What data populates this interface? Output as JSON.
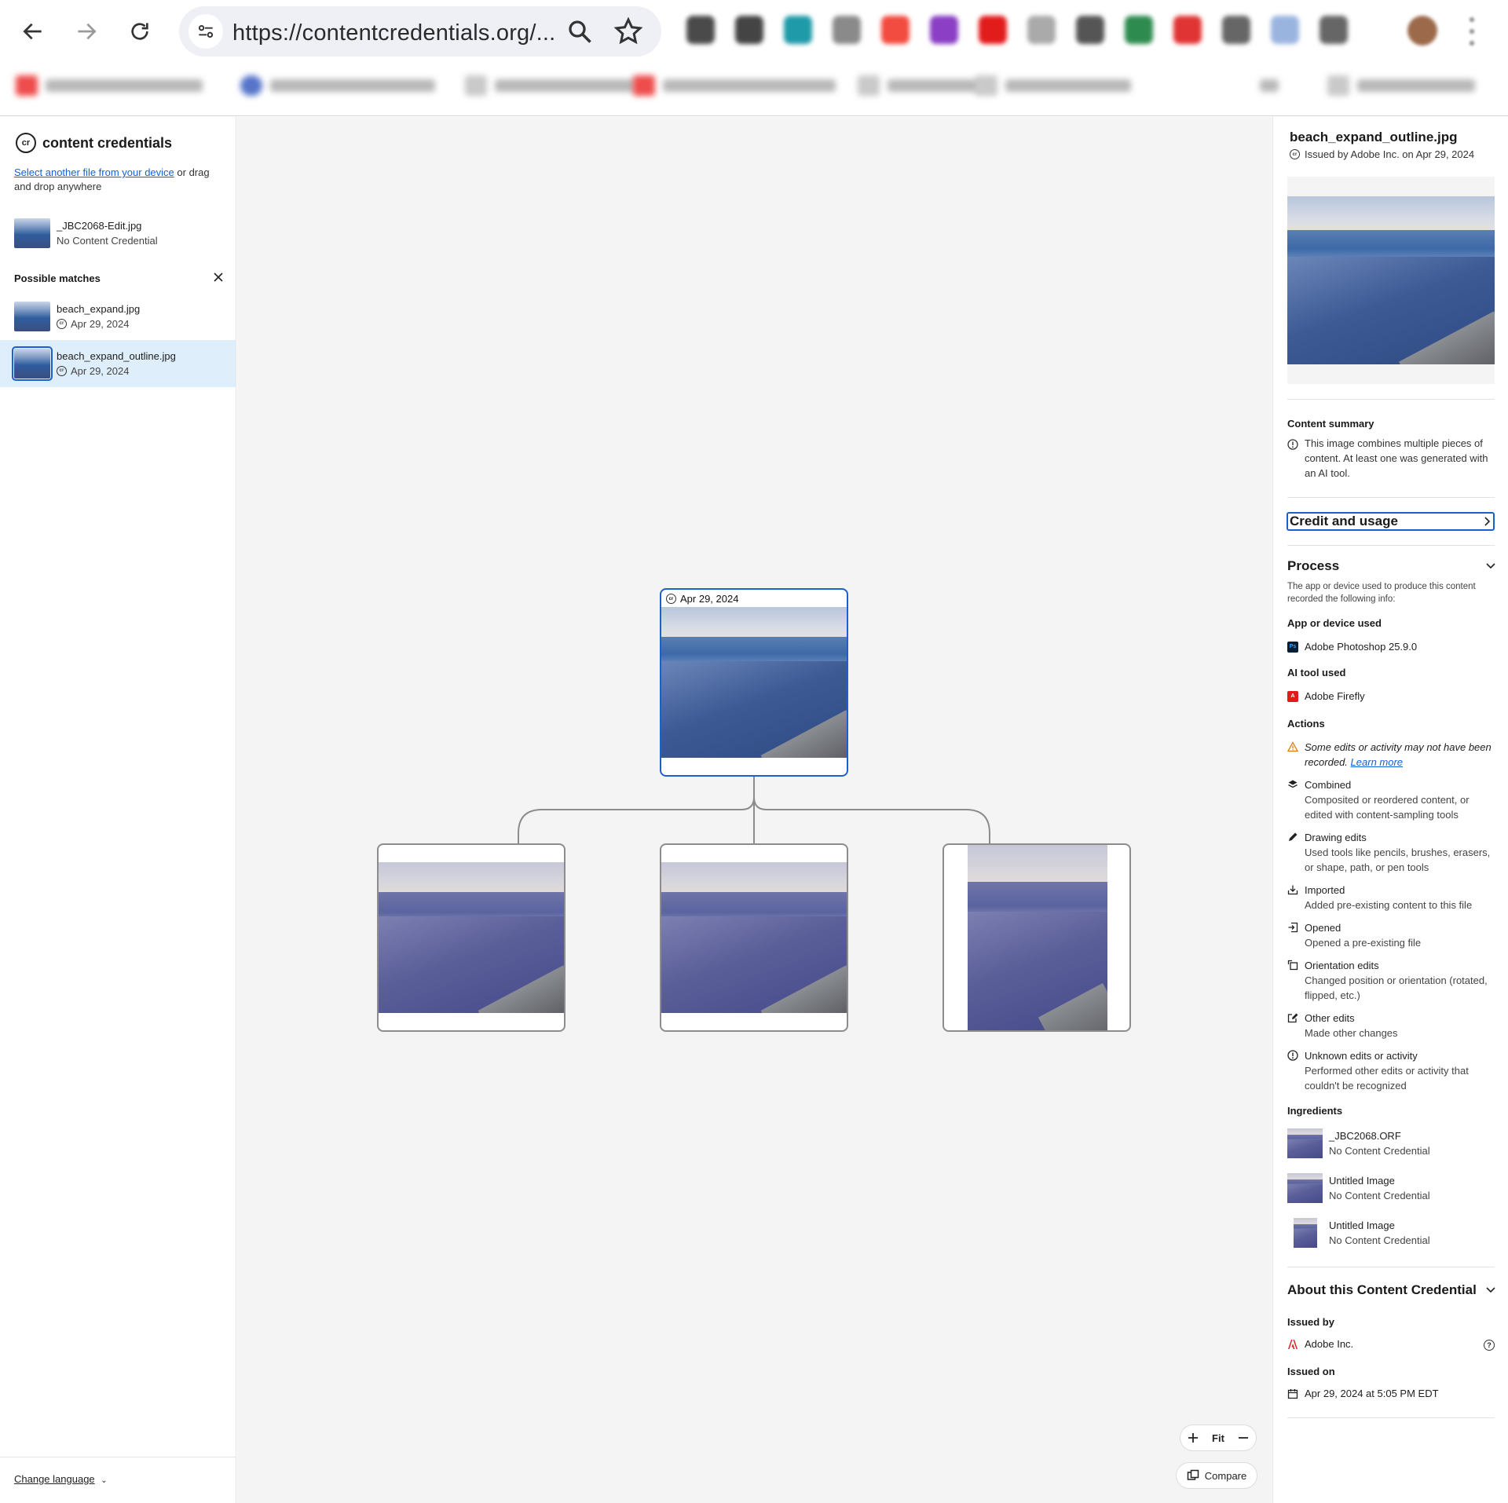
{
  "browser": {
    "url": "https://contentcredentials.org/...",
    "extension_colors": [
      "#4a4a4a",
      "#444444",
      "#1f9aa8",
      "#8a8a8a",
      "#f24b3f",
      "#8a3fc4",
      "#e21b1b",
      "#aaaaaa",
      "#555555",
      "#2e8b4f",
      "#e03434",
      "#666666",
      "#9ab4e0",
      "#666666"
    ]
  },
  "left": {
    "brand": "content credentials",
    "select_link": "Select another file from your device",
    "select_rest": " or drag and drop anywhere",
    "current_file": {
      "name": "_JBC2068-Edit.jpg",
      "status": "No Content Credential"
    },
    "possible_matches_label": "Possible matches",
    "matches": [
      {
        "name": "beach_expand.jpg",
        "date": "Apr 29, 2024"
      },
      {
        "name": "beach_expand_outline.jpg",
        "date": "Apr 29, 2024"
      }
    ],
    "change_language": "Change language"
  },
  "canvas": {
    "root_date": "Apr 29, 2024",
    "fit_label": "Fit",
    "compare_label": "Compare"
  },
  "panel": {
    "title": "beach_expand_outline.jpg",
    "issued": "Issued by Adobe Inc. on Apr 29, 2024",
    "content_summary_label": "Content summary",
    "content_summary": "This image combines multiple pieces of content. At least one was generated with an AI tool.",
    "credit_usage": "Credit and usage",
    "process_label": "Process",
    "process_note": "The app or device used to produce this content recorded the following info:",
    "app_label": "App or device used",
    "app": "Adobe Photoshop 25.9.0",
    "ai_label": "AI tool used",
    "ai_tool": "Adobe Firefly",
    "actions_label": "Actions",
    "warning_text": "Some edits or activity may not have been recorded.",
    "learn_more": "Learn more",
    "actions": [
      {
        "title": "Combined",
        "desc": "Composited or reordered content, or edited with content-sampling tools"
      },
      {
        "title": "Drawing edits",
        "desc": "Used tools like pencils, brushes, erasers, or shape, path, or pen tools"
      },
      {
        "title": "Imported",
        "desc": "Added pre-existing content to this file"
      },
      {
        "title": "Opened",
        "desc": "Opened a pre-existing file"
      },
      {
        "title": "Orientation edits",
        "desc": "Changed position or orientation (rotated, flipped, etc.)"
      },
      {
        "title": "Other edits",
        "desc": "Made other changes"
      },
      {
        "title": "Unknown edits or activity",
        "desc": "Performed other edits or activity that couldn't be recognized"
      }
    ],
    "ingredients_label": "Ingredients",
    "ingredients": [
      {
        "name": "_JBC2068.ORF",
        "status": "No Content Credential"
      },
      {
        "name": "Untitled Image",
        "status": "No Content Credential"
      },
      {
        "name": "Untitled Image",
        "status": "No Content Credential"
      }
    ],
    "about_label": "About this Content Credential",
    "issued_by_label": "Issued by",
    "issued_by": "Adobe Inc.",
    "issued_on_label": "Issued on",
    "issued_on": "Apr 29, 2024 at 5:05 PM EDT"
  },
  "colors": {
    "accent": "#1c5fcf",
    "link": "#1660d6",
    "selected_row": "#dfeefb",
    "canvas_bg": "#f4f4f4"
  }
}
